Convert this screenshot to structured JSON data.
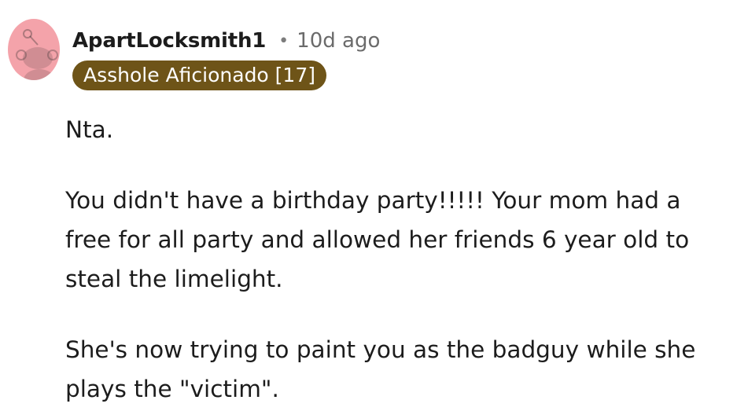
{
  "comment": {
    "author": "ApartLocksmith1",
    "separator": "•",
    "time": "10d ago",
    "flair": "Asshole Aficionado [17]",
    "flair_color": "#6e5418",
    "avatar_color": "#f4a3aa",
    "avatar_icon": "snoo-avatar-icon",
    "paragraphs": [
      "Nta.",
      "You didn't have a birthday party!!!!! Your mom had a free for all party and allowed her friends 6 year old to steal the limelight.",
      "She's now trying to paint you as the badguy while she plays the \"victim\"."
    ]
  }
}
